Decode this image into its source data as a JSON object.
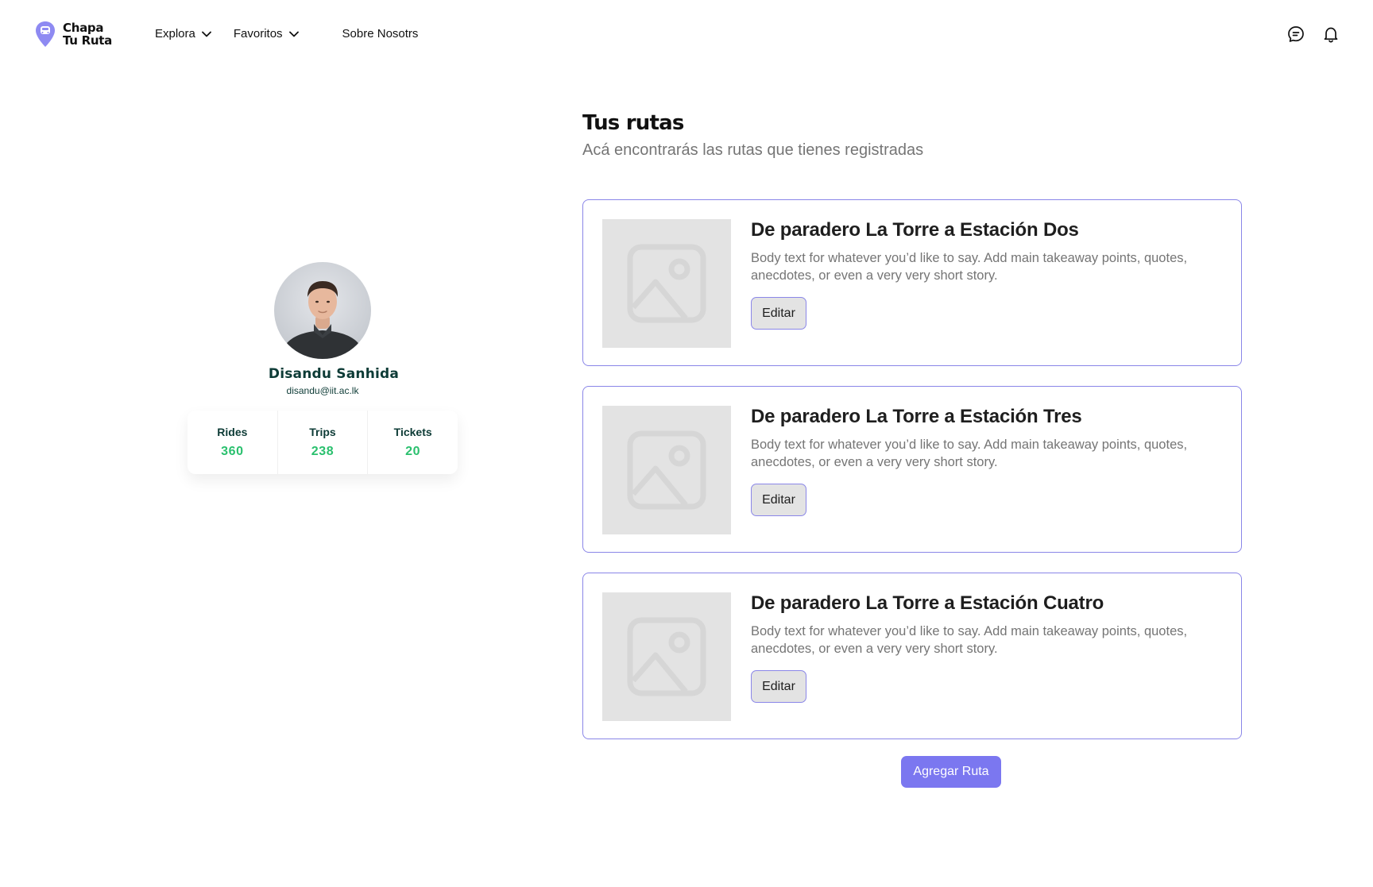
{
  "brand": {
    "line1": "Chapa",
    "line2": "Tu Ruta",
    "accent_color": "#7b77f0"
  },
  "nav": {
    "items": [
      {
        "label": "Explora",
        "icon": "chevron-down-icon"
      },
      {
        "label": "Favoritos",
        "icon": "chevron-down-icon"
      },
      {
        "label": "Sobre Nosotrs"
      }
    ],
    "icons": [
      "message-icon",
      "bell-icon"
    ]
  },
  "profile": {
    "name": "Disandu Sanhida",
    "email": "disandu@iit.ac.lk",
    "stats": [
      {
        "label": "Rides",
        "value": "360"
      },
      {
        "label": "Trips",
        "value": "238"
      },
      {
        "label": "Tickets",
        "value": "20"
      }
    ]
  },
  "main": {
    "title": "Tus rutas",
    "subtitle": "Acá encontrarás las rutas que tienes registradas",
    "routes": [
      {
        "title": "De paradero La Torre a Estación Dos",
        "body": "Body text for whatever you’d like to say. Add main takeaway points, quotes, anecdotes, or even a very very short story.",
        "button": "Editar"
      },
      {
        "title": "De paradero La Torre a Estación Tres",
        "body": "Body text for whatever you’d like to say. Add main takeaway points, quotes, anecdotes, or even a very very short story.",
        "button": "Editar"
      },
      {
        "title": "De paradero La Torre a Estación Cuatro",
        "body": "Body text for whatever you’d like to say. Add main takeaway points, quotes, anecdotes, or even a very very short story.",
        "button": "Editar"
      }
    ],
    "add_button": "Agregar Ruta"
  }
}
